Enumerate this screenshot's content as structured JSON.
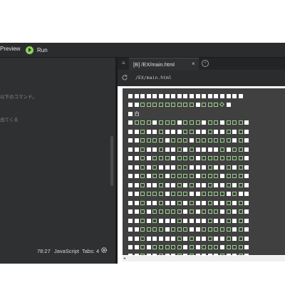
{
  "toolbar": {
    "preview_label": "Preview",
    "run_label": "Run"
  },
  "editor": {
    "lines": [
      "以下のコマンド。",
      "出てくる"
    ],
    "status": {
      "position": "78:27",
      "language": "JavaScript",
      "tabs": "Tabs: 4"
    }
  },
  "preview": {
    "tab_menu_icon": "≡",
    "tab_title": "[B] /EX/main.html",
    "tab_close": "×",
    "url": "/EX/main.html",
    "grid_rows": [
      "WWWWWWWWWWWWWWWWWWW",
      "WWGGGGGGGGGWGGGDW",
      "WT",
      "WGGGWGGGWGGGWGGWGGGW",
      "WWGWWGWWWGGWWGWWGWGW",
      "WWGGGGWGGGWGGGGGGWGW",
      "WWGWWGWWGWGWWWWGWGGW",
      "WWGWGGGWGGGWGGGGGGGW",
      "WWGWGWWWGGWWWGWWGWGW",
      "WWGWGGWGGGGWGGGWGGGW",
      "WWGWWGWWGWGWWGWWGWGW",
      "WWGGGGWGGGWWGGGGWGWW",
      "WWGWWGWWGWGWWGWWGWGW",
      "WWGWGGGGGWGWGGGWGWGW",
      "WWGWGWWWGWWWWGWWGWGW",
      "WWGGGGWGGGWWGGGGGWGW",
      "WWGWWWWWGWGWWGWWGWGW",
      "WWGWGGGGGWGWGGGWGGGW",
      "WWGWWGWWGWGWWWWGWWGW",
      "WWGGGGWGGGWGGGGGGGGW",
      "WWWWWWWWWWWWWWWWWWWW"
    ],
    "grid_char": "白"
  },
  "colors": {
    "run": "#8bd35a",
    "cell_border": "#9bd08b",
    "cell_fill": "#ffffff"
  }
}
